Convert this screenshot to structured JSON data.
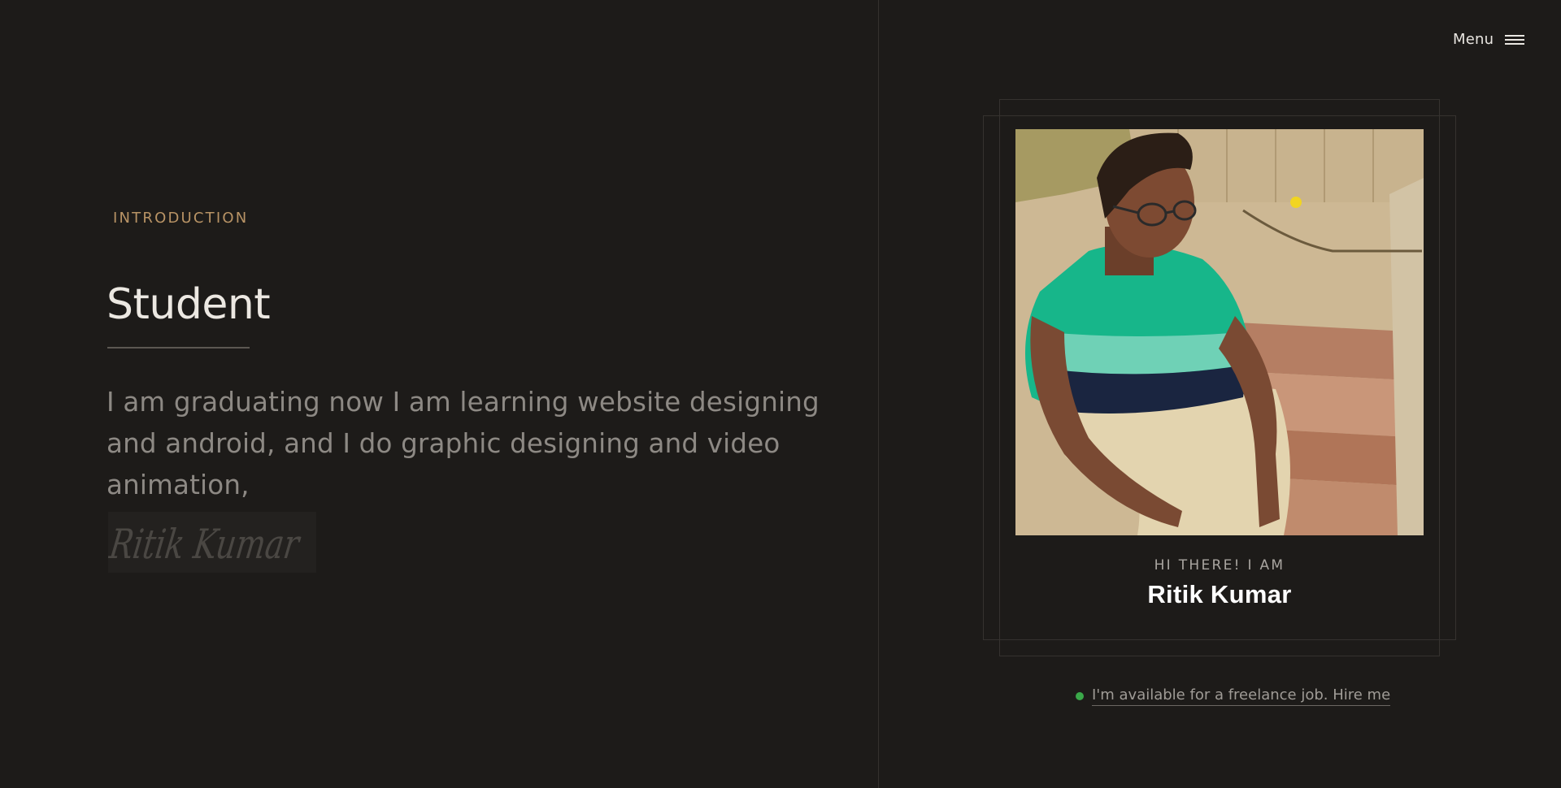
{
  "header": {
    "menu_label": "Menu",
    "menu_icon": "hamburger-icon"
  },
  "intro": {
    "label": "INTRODUCTION",
    "title": "Student",
    "bio": "I am graduating now I am learning website designing and android, and I do graphic designing and video animation,",
    "signature": "Ritik Kumar"
  },
  "profile": {
    "photo_alt": "Photo of Ritik Kumar sitting on steps",
    "greeting": "HI THERE! I AM",
    "name": "Ritik Kumar"
  },
  "availability": {
    "status_color": "#3aa849",
    "link_text": "I'm available for a freelance job. Hire me"
  },
  "colors": {
    "background": "#1d1b19",
    "accent": "#b89365"
  }
}
